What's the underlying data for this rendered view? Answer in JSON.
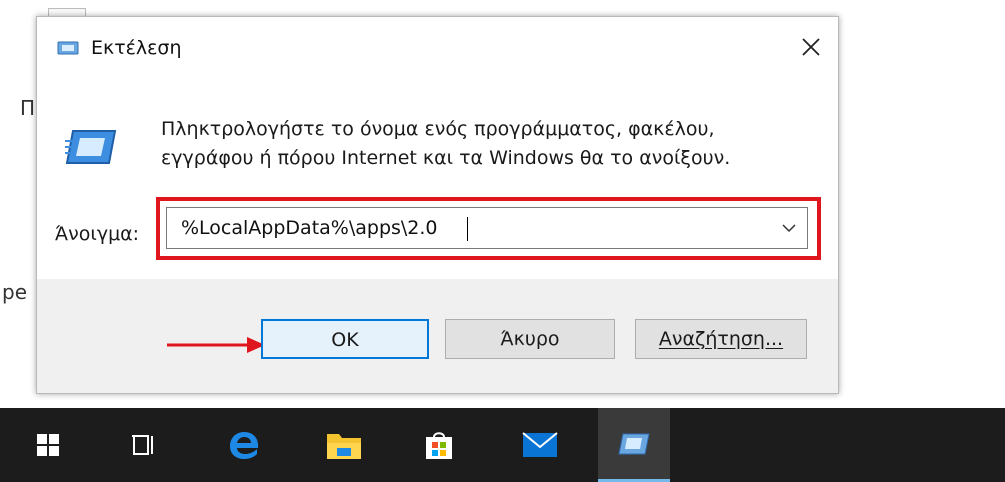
{
  "dialog": {
    "title": "Εκτέλεση",
    "description": "Πληκτρολογήστε το όνομα ενός προγράμματος, φακέλου, εγγράφου ή πόρου Internet και τα Windows θα το ανοίξουν.",
    "open_label": "Άνοιγμα:",
    "open_value": "%LocalAppData%\\apps\\2.0",
    "ok_label": "OK",
    "cancel_label": "Άκυρο",
    "browse_label": "Αναζήτηση..."
  },
  "background": {
    "fragment_1": "Π",
    "fragment_2": "pe"
  },
  "taskbar": {
    "items": [
      "start-icon",
      "task-view-icon",
      "edge-icon",
      "file-explorer-icon",
      "store-icon",
      "mail-icon",
      "run-icon"
    ]
  },
  "colors": {
    "highlight": "#e0161f",
    "ok_border": "#0078d7",
    "taskbar": "#1c1c1c"
  }
}
